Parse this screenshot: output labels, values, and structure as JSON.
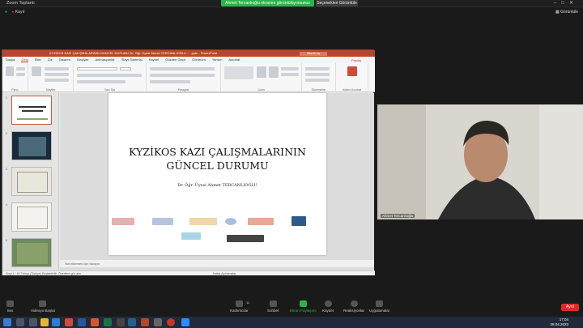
{
  "zoom": {
    "title": "Zoom Toplantı",
    "share_banner": "Ahmet Tercanlıoğlu ekranını görüntülüyorsunuz",
    "stop_share": "Seçenekleri Görüntüle",
    "record_label": "Kayıt",
    "view_label": "Görüntüle",
    "participant_name": "Ahmet Tercanlıoğlu",
    "toolbar": [
      {
        "label": "Ses",
        "icon": "microphone-icon"
      },
      {
        "label": "Videoyu Başlat",
        "icon": "video-camera-icon"
      },
      {
        "label": "Katılımcılar",
        "icon": "participants-icon",
        "count": "11"
      },
      {
        "label": "Sohbet",
        "icon": "chat-icon"
      },
      {
        "label": "Ekran Paylaşımı",
        "icon": "share-screen-icon"
      },
      {
        "label": "Kaydet",
        "icon": "record-icon"
      },
      {
        "label": "Reaksiyonlar",
        "icon": "reactions-icon"
      },
      {
        "label": "Uygulamalar",
        "icon": "apps-icon"
      }
    ],
    "leave": "Ayrıl"
  },
  "ppt": {
    "title": "KYZİKOS KAZI ÇALIŞMALARININ GÜNCEL DURUMU Dr. Öğr. Üyesi Ahmet TERCANLIOĞLU ... .pptx - PowerPoint",
    "login": "Oturum aç",
    "share": "Paylaş",
    "menu": [
      "Dosya",
      "Giriş",
      "Ekle",
      "Çiz",
      "Tasarım",
      "Geçişler",
      "Animasyonlar",
      "Slayt Gösterisi",
      "Kaydet",
      "Gözden Geçir",
      "Görünüm",
      "Yardım",
      "Acrobat"
    ],
    "ribbon_groups": [
      "Pano",
      "Slaytlar",
      "Yazı Tipi",
      "Paragraf",
      "Çizim",
      "Düzenleme",
      "Adobe Acrobat"
    ],
    "slide_numbers": [
      "1",
      "2",
      "3",
      "4",
      "5"
    ],
    "slide": {
      "title_line1": "KYZİKOS KAZI ÇALIŞMALARININ",
      "title_line2": "GÜNCEL DURUMU",
      "author": "Dr. Öğr. Üyesi Ahmet TERCANLIOĞLU"
    },
    "notes": "Not eklemek için tıklayın",
    "status": "Slayt 1 / 40   Türkçe (Türkiye)   Erişilebilirlik: Önerilere göz atın",
    "status_right": "Notlar   Açıklamalar"
  },
  "taskbar": {
    "time": "17:04",
    "date": "28.04.2023"
  },
  "colors": {
    "zoom_green": "#2db34a",
    "ppt_red": "#b7472a",
    "leave_red": "#e02828"
  }
}
